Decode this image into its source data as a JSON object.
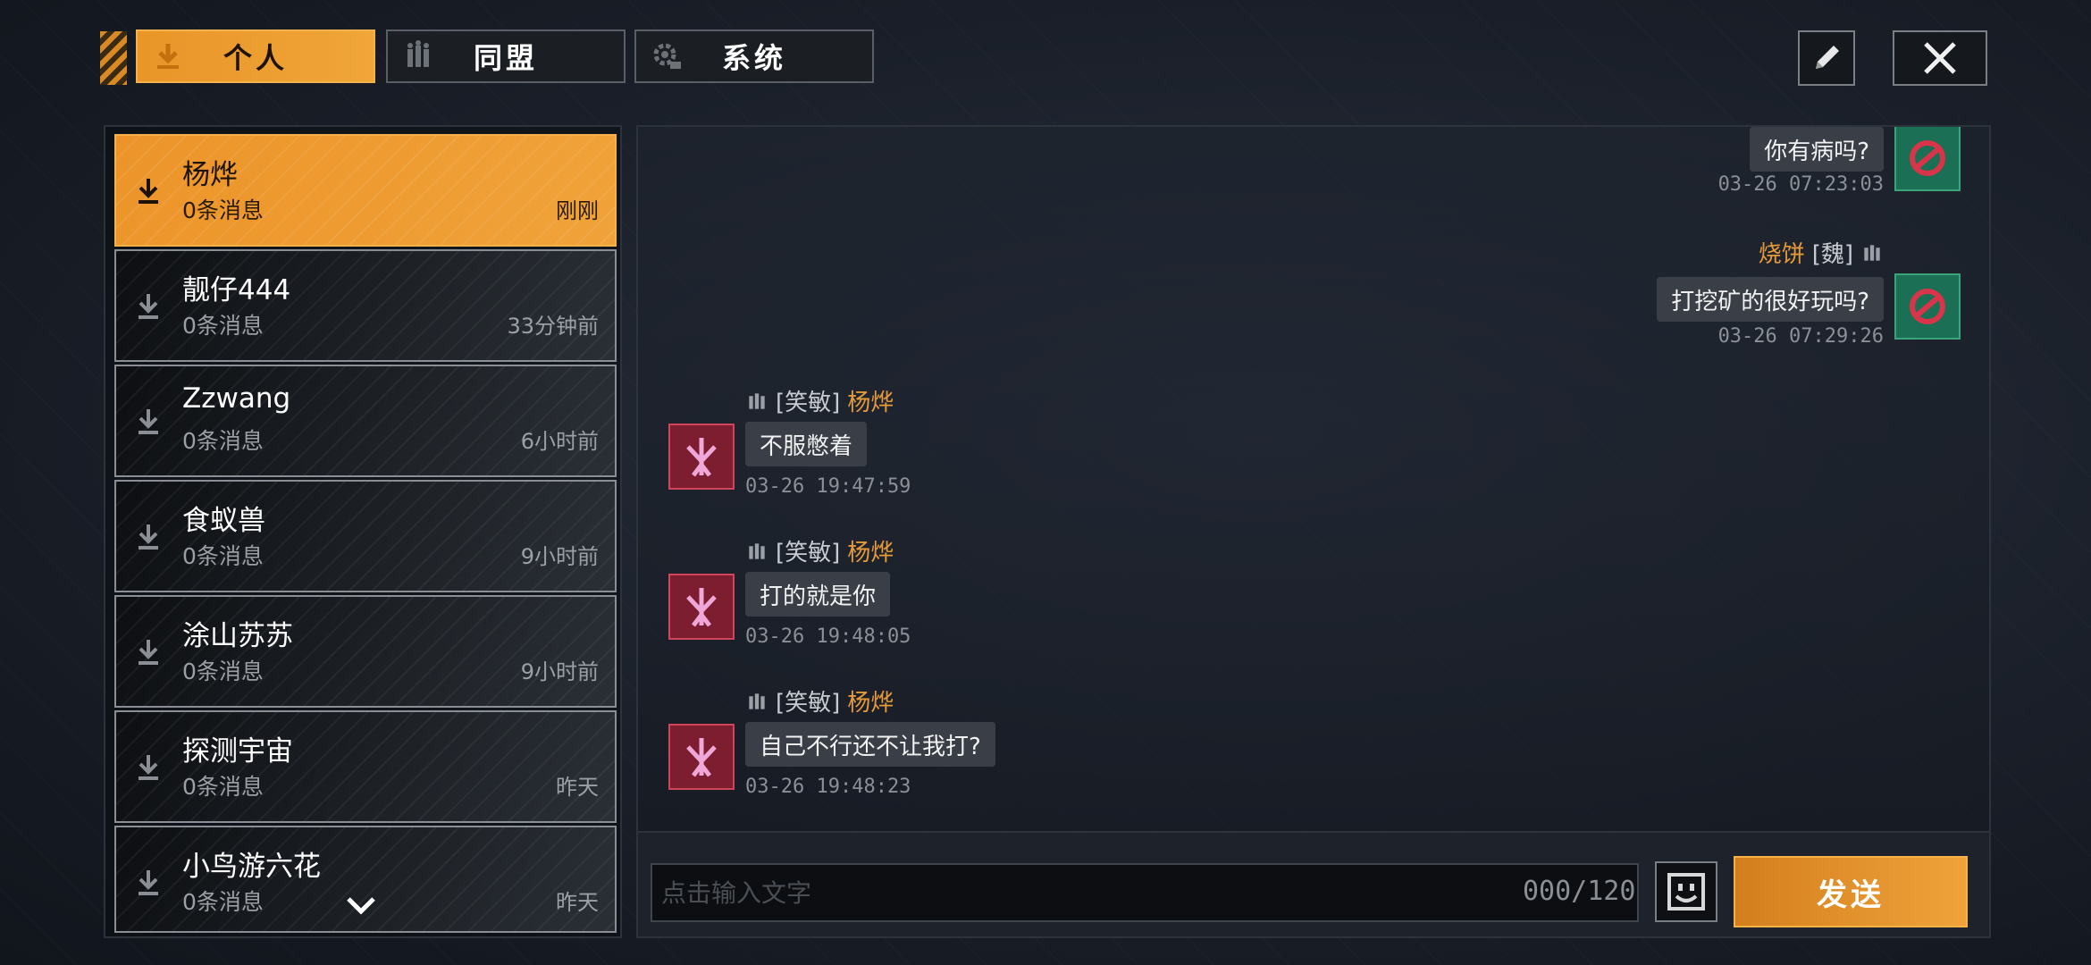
{
  "tabs": [
    {
      "label": "个人",
      "icon": "arrow-down-icon",
      "active": true
    },
    {
      "label": "同盟",
      "icon": "alliance-icon",
      "active": false
    },
    {
      "label": "系统",
      "icon": "gear-icon",
      "active": false
    }
  ],
  "contacts": [
    {
      "name": "杨烨",
      "messages": "0条消息",
      "time": "刚刚",
      "active": true
    },
    {
      "name": "靓仔444",
      "messages": "0条消息",
      "time": "33分钟前"
    },
    {
      "name": "Zzwang",
      "messages": "0条消息",
      "time": "6小时前"
    },
    {
      "name": "食蚁兽",
      "messages": "0条消息",
      "time": "9小时前"
    },
    {
      "name": "涂山苏苏",
      "messages": "0条消息",
      "time": "9小时前"
    },
    {
      "name": "探测宇宙",
      "messages": "0条消息",
      "time": "昨天"
    },
    {
      "name": "小鸟游六花",
      "messages": "0条消息",
      "time": "昨天"
    }
  ],
  "messages": [
    {
      "side": "right",
      "text": "你有病吗?",
      "timestamp": "03-26 07:23:03"
    },
    {
      "side": "right",
      "sender_name": "烧饼",
      "sender_tag": "[魏]",
      "text": "打挖矿的很好玩吗?",
      "timestamp": "03-26 07:29:26"
    },
    {
      "side": "left",
      "sender_tag": "[笑敏]",
      "sender_name": "杨烨",
      "text": "不服憋着",
      "timestamp": "03-26 19:47:59"
    },
    {
      "side": "left",
      "sender_tag": "[笑敏]",
      "sender_name": "杨烨",
      "text": "打的就是你",
      "timestamp": "03-26 19:48:05"
    },
    {
      "side": "left",
      "sender_tag": "[笑敏]",
      "sender_name": "杨烨",
      "text": "自己不行还不让我打?",
      "timestamp": "03-26 19:48:23"
    }
  ],
  "input": {
    "placeholder": "点击输入文字",
    "char_count": "000/120"
  },
  "send_label": "发送",
  "colors": {
    "accent": "#f0a33a",
    "name": "#e59a3a",
    "bubble": "#3a3f47"
  }
}
